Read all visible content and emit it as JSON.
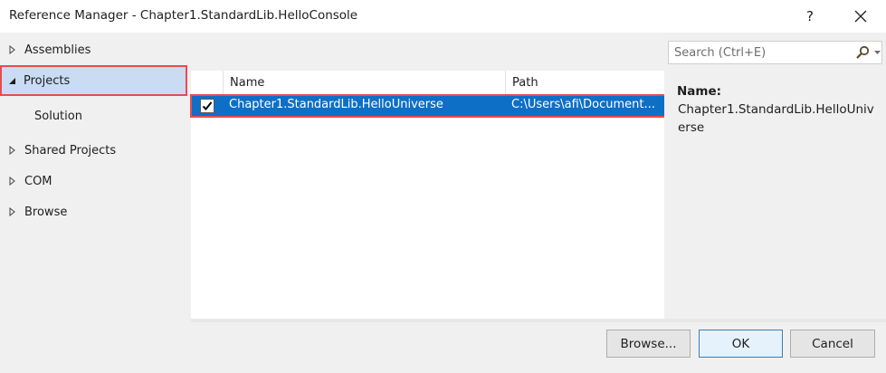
{
  "window": {
    "title": "Reference Manager - Chapter1.StandardLib.HelloConsole",
    "help_label": "?"
  },
  "nav": {
    "items": [
      {
        "label": "Assemblies",
        "icon": "triangle-right-icon",
        "expanded": false
      },
      {
        "label": "Projects",
        "icon": "triangle-down-icon",
        "expanded": true,
        "selected": true
      },
      {
        "label": "Solution",
        "sub": true
      },
      {
        "label": "Shared Projects",
        "icon": "triangle-right-icon",
        "expanded": false
      },
      {
        "label": "COM",
        "icon": "triangle-right-icon",
        "expanded": false
      },
      {
        "label": "Browse",
        "icon": "triangle-right-icon",
        "expanded": false
      }
    ]
  },
  "grid": {
    "columns": [
      "Name",
      "Path"
    ],
    "rows": [
      {
        "checked": true,
        "name": "Chapter1.StandardLib.HelloUniverse",
        "path": "C:\\Users\\afi\\Document..."
      }
    ]
  },
  "details": {
    "search_placeholder": "Search (Ctrl+E)",
    "name_label": "Name:",
    "name_value": "Chapter1.StandardLib.HelloUniverse"
  },
  "buttons": {
    "browse": "Browse...",
    "ok": "OK",
    "cancel": "Cancel"
  },
  "colors": {
    "selection": "#0e6fc7",
    "highlight_border": "#e84c4c",
    "nav_selected_bg": "#c9dcf3"
  }
}
